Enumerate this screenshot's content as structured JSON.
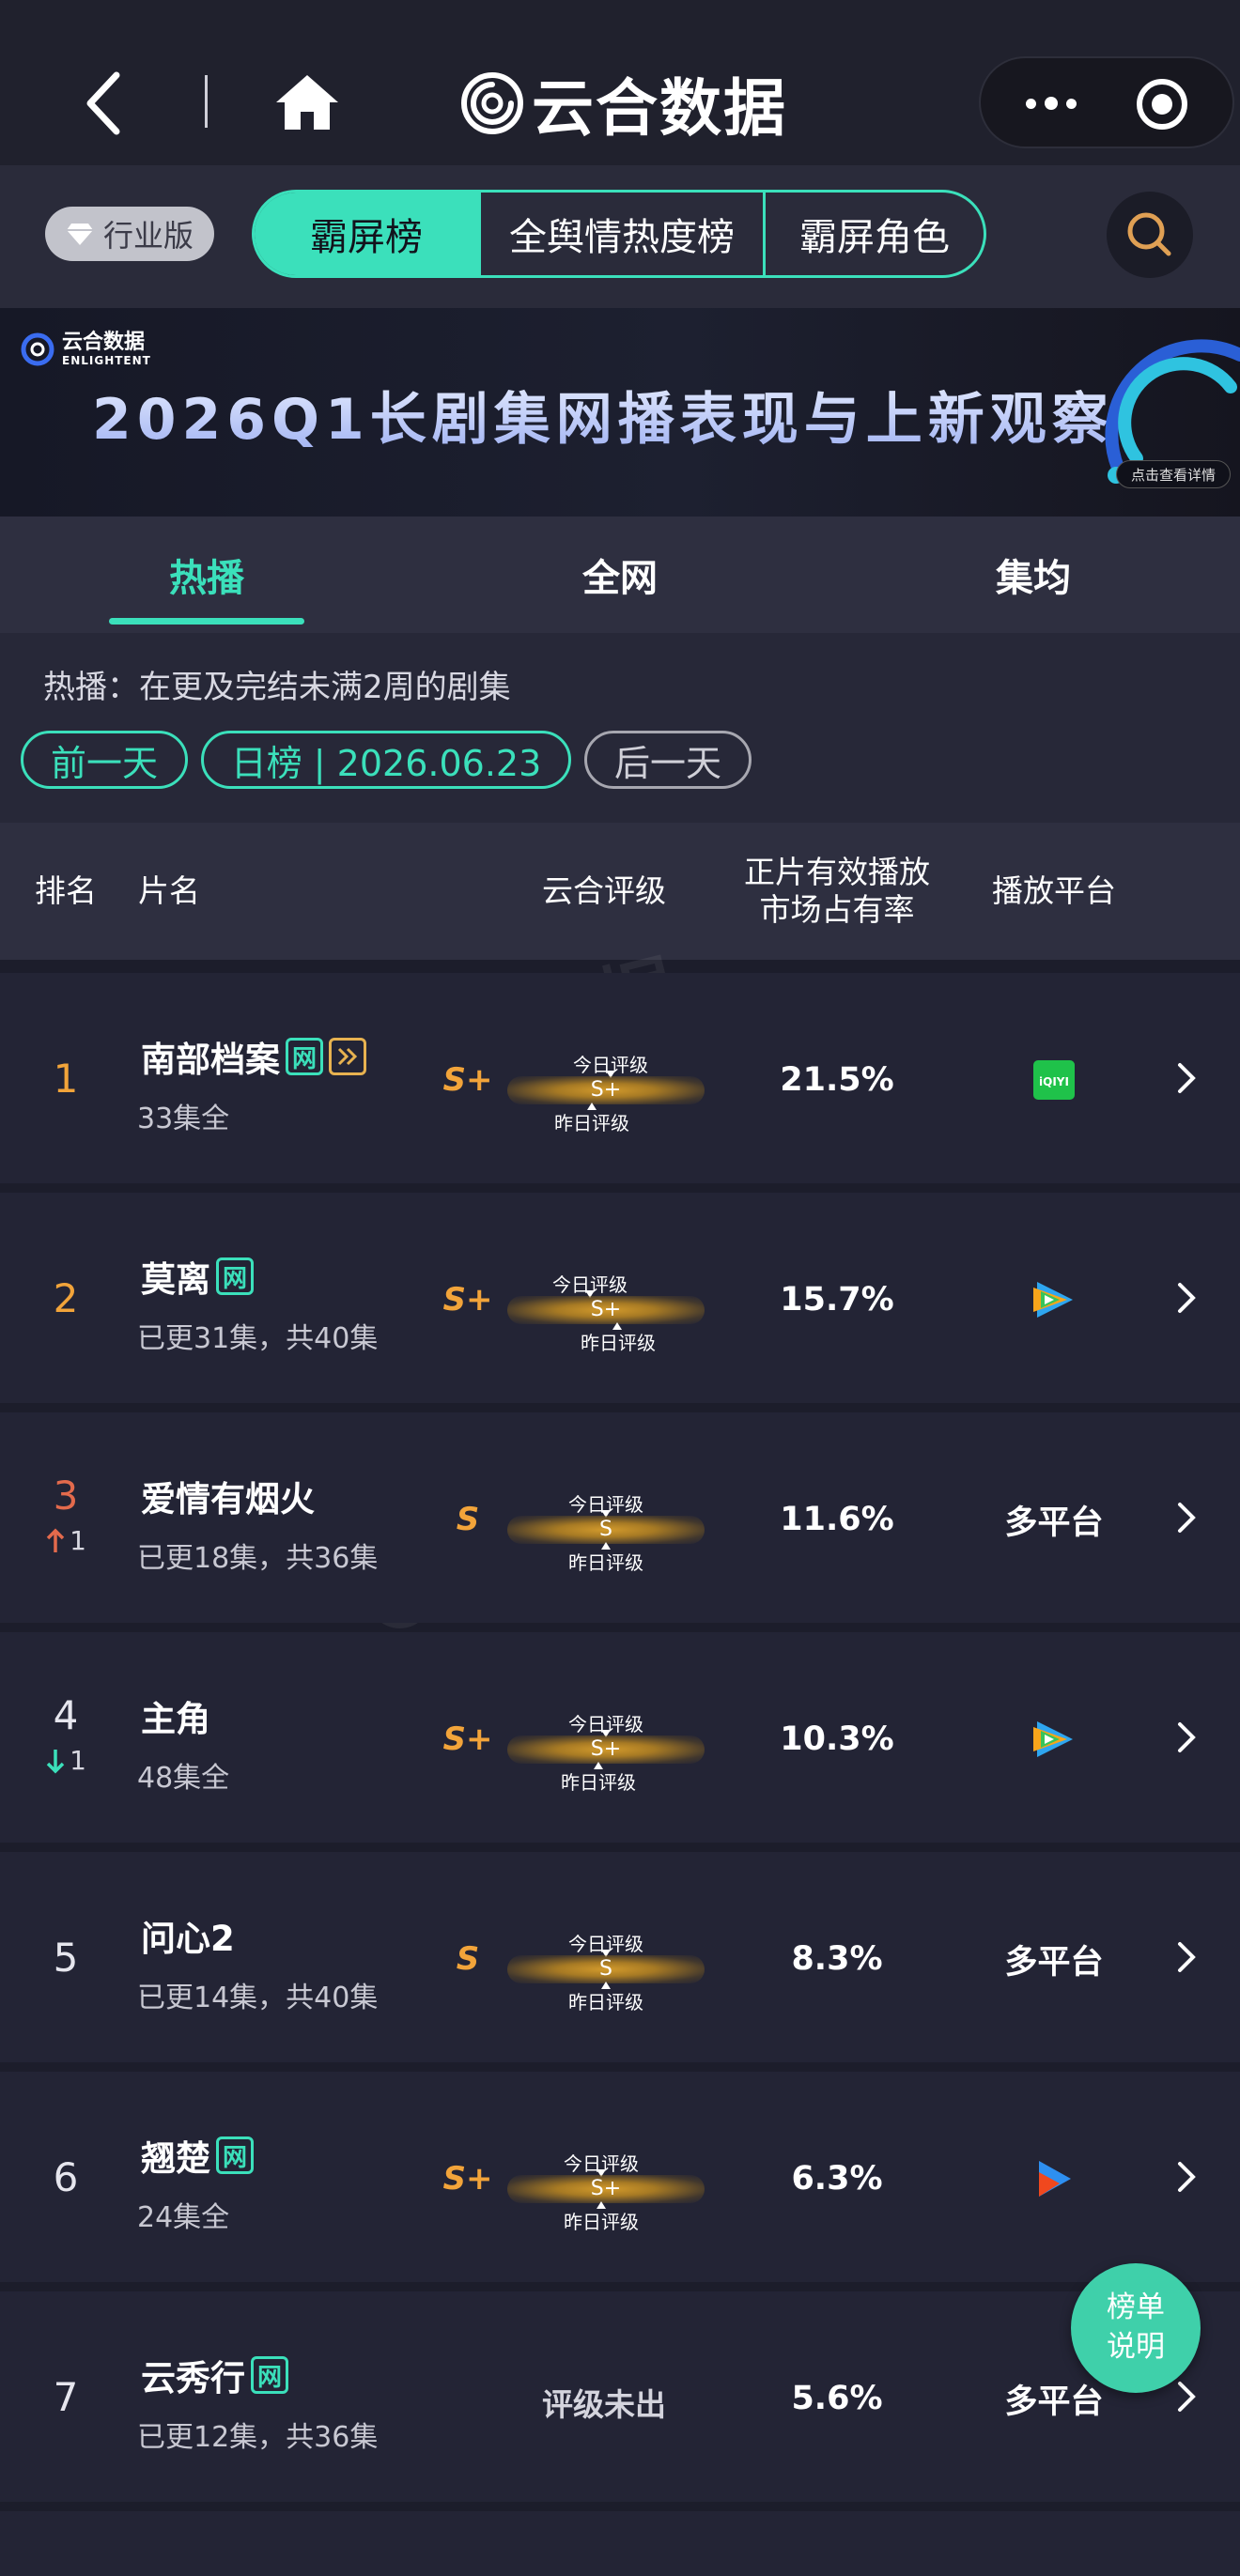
{
  "nav": {
    "brand": "云合数据",
    "back_icon": "chevron-left-icon",
    "home_icon": "home-icon",
    "more_icon": "more-dots-icon",
    "close_icon": "target-close-icon"
  },
  "category": {
    "edition_label": "行业版",
    "tabs": [
      {
        "label": "霸屏榜",
        "active": true
      },
      {
        "label": "全舆情热度榜",
        "active": false
      },
      {
        "label": "霸屏角色",
        "active": false
      }
    ],
    "accent": "#3be0bb"
  },
  "banner": {
    "logo_cn": "云合数据",
    "logo_en": "ENLIGHTENT",
    "title": "2026Q1长剧集网播表现与上新观察",
    "link": "点击查看详情"
  },
  "subtabs": [
    {
      "label": "热播",
      "active": true
    },
    {
      "label": "全网",
      "active": false
    },
    {
      "label": "集均",
      "active": false
    }
  ],
  "info": {
    "note": "热播：在更及完结未满2周的剧集",
    "prev_day": "前一天",
    "date": "日榜 | 2026.06.23",
    "next_day": "后一天"
  },
  "table": {
    "headers": {
      "rank": "排名",
      "name": "片名",
      "grade": "云合评级",
      "share_line1": "正片有效播放",
      "share_line2": "市场占有率",
      "platform": "播放平台"
    },
    "gauge_today_label": "今日评级",
    "gauge_yesterday_label": "昨日评级",
    "rows": [
      {
        "rank": "1",
        "rank_color": "#f2a43a",
        "change_dir": "",
        "change": "",
        "title": "南部档案",
        "tags": [
          "网",
          "play"
        ],
        "subtitle": "33集全",
        "grade": "S+",
        "grade_inner": "S+",
        "share": "21.5%",
        "platform_text": "",
        "platform_icon": "iqiyi-icon"
      },
      {
        "rank": "2",
        "rank_color": "#f2a43a",
        "change_dir": "",
        "change": "",
        "title": "莫离",
        "tags": [
          "网"
        ],
        "subtitle": "已更31集，共40集",
        "grade": "S+",
        "grade_inner": "S+",
        "share": "15.7%",
        "platform_text": "",
        "platform_icon": "tencent-video-icon"
      },
      {
        "rank": "3",
        "rank_color": "#e36a4c",
        "change_dir": "up",
        "change": "1",
        "title": "爱情有烟火",
        "tags": [],
        "subtitle": "已更18集，共36集",
        "grade": "S",
        "grade_inner": "S",
        "share": "11.6%",
        "platform_text": "多平台",
        "platform_icon": ""
      },
      {
        "rank": "4",
        "rank_color": "#e6e6ee",
        "change_dir": "down",
        "change": "1",
        "title": "主角",
        "tags": [],
        "subtitle": "48集全",
        "grade": "S+",
        "grade_inner": "S+",
        "share": "10.3%",
        "platform_text": "",
        "platform_icon": "tencent-video-icon"
      },
      {
        "rank": "5",
        "rank_color": "#e6e6ee",
        "change_dir": "",
        "change": "",
        "title": "问心2",
        "tags": [],
        "subtitle": "已更14集，共40集",
        "grade": "S",
        "grade_inner": "S",
        "share": "8.3%",
        "platform_text": "多平台",
        "platform_icon": ""
      },
      {
        "rank": "6",
        "rank_color": "#e6e6ee",
        "change_dir": "",
        "change": "",
        "title": "翘楚",
        "tags": [
          "网"
        ],
        "subtitle": "24集全",
        "grade": "S+",
        "grade_inner": "S+",
        "share": "6.3%",
        "platform_text": "",
        "platform_icon": "youku-icon"
      },
      {
        "rank": "7",
        "rank_color": "#e6e6ee",
        "change_dir": "",
        "change": "",
        "title": "云秀行",
        "tags": [
          "网"
        ],
        "subtitle": "已更12集，共36集",
        "grade": "",
        "grade_inner": "",
        "grade_none": "评级未出",
        "share": "5.6%",
        "platform_text": "多平台",
        "platform_icon": ""
      }
    ]
  },
  "watermark": {
    "brand_cn": "云合数据",
    "brand_en": "ENLIGHTENT",
    "handle": "@ 9781882"
  },
  "fab": {
    "line1": "榜单",
    "line2": "说明"
  }
}
